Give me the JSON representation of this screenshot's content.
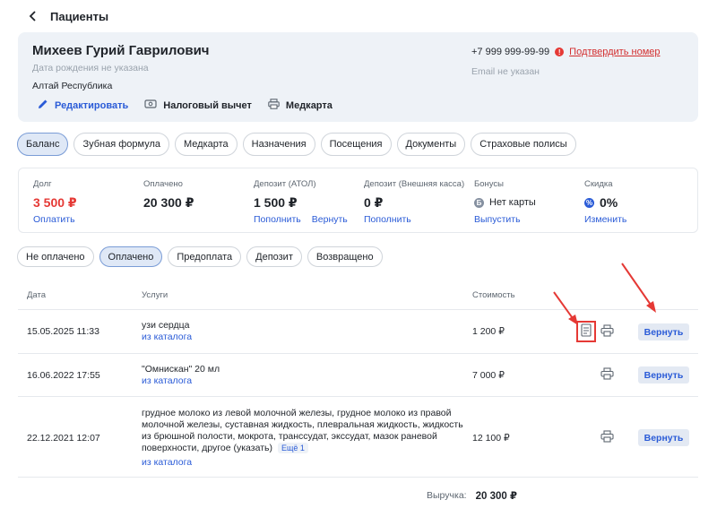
{
  "header": {
    "title": "Пациенты"
  },
  "patient": {
    "name": "Михеев Гурий Гаврилович",
    "dob": "Дата рождения не указана",
    "region": "Алтай Республика",
    "phone": "+7 999 999-99-99",
    "confirm_label": "Подтвердить номер",
    "email": "Email не указан",
    "actions": {
      "edit": "Редактировать",
      "tax": "Налоговый вычет",
      "medcard": "Медкарта"
    }
  },
  "tabs": [
    "Баланс",
    "Зубная формула",
    "Медкарта",
    "Назначения",
    "Посещения",
    "Документы",
    "Страховые полисы"
  ],
  "summary": {
    "debt": {
      "label": "Долг",
      "value": "3 500 ₽",
      "link": "Оплатить"
    },
    "paid": {
      "label": "Оплачено",
      "value": "20 300 ₽"
    },
    "deposit_atol": {
      "label": "Депозит (АТОЛ)",
      "value": "1 500 ₽",
      "link1": "Пополнить",
      "link2": "Вернуть"
    },
    "deposit_ext": {
      "label": "Депозит (Внешняя касса)",
      "value": "0 ₽",
      "link": "Пополнить"
    },
    "bonus": {
      "label": "Бонусы",
      "icon_text": "Б",
      "value": "Нет карты",
      "link": "Выпустить"
    },
    "discount": {
      "label": "Скидка",
      "icon_text": "%",
      "value": "0%",
      "link": "Изменить"
    }
  },
  "filters": [
    "Не оплачено",
    "Оплачено",
    "Предоплата",
    "Депозит",
    "Возвращено"
  ],
  "table": {
    "headers": {
      "date": "Дата",
      "services": "Услуги",
      "cost": "Стоимость"
    },
    "rows": [
      {
        "date": "15.05.2025 11:33",
        "service": "узи сердца",
        "source": "из каталога",
        "cost": "1 200 ₽",
        "return_label": "Вернуть"
      },
      {
        "date": "16.06.2022 17:55",
        "service": "\"Омнискан\" 20 мл",
        "source": "из каталога",
        "cost": "7 000 ₽",
        "return_label": "Вернуть"
      },
      {
        "date": "22.12.2021 12:07",
        "service_lines": [
          "грудное молоко из левой молочной железы, грудное молоко из правой",
          "молочной железы, суставная жидкость, плевральная жидкость, жидкость",
          "из брюшной полости, мокрота, транссудат, экссудат, мазок раневой",
          "поверхности, другое (указать)"
        ],
        "more": "Ещё 1",
        "source": "из каталога",
        "cost": "12 100 ₽",
        "return_label": "Вернуть"
      }
    ]
  },
  "total": {
    "label": "Выручка:",
    "value": "20 300 ₽"
  },
  "colors": {
    "accent": "#2a5bd7",
    "danger": "#e53935",
    "card_bg": "#eef2f7"
  }
}
